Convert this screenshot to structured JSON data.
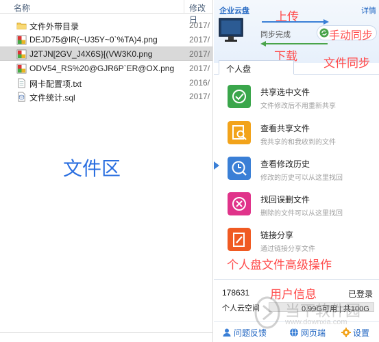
{
  "file_list": {
    "header_name": "名称",
    "header_modified": "修改日",
    "files": [
      {
        "name": "文件外带目录",
        "date": "2017/",
        "icon": "folder-icon"
      },
      {
        "name": "DEJD75@IR(~U35Y~0`%TA)4.png",
        "date": "2017/",
        "icon": "png-file-icon"
      },
      {
        "name": "J2TJN[2GV_J4X6S}[(VW3K0.png",
        "date": "2017/",
        "icon": "png-file-icon"
      },
      {
        "name": "ODV54_RS%20@GJR6P`ER@OX.png",
        "date": "2017/",
        "icon": "png-file-icon"
      },
      {
        "name": "网卡配置项.txt",
        "date": "2016/",
        "icon": "txt-file-icon"
      },
      {
        "name": "文件统计.sql",
        "date": "2017/",
        "icon": "sql-file-icon"
      }
    ],
    "zone_label": "文件区"
  },
  "sync_panel": {
    "brand": "企业云盘",
    "details": "详情",
    "upload_label": "上传",
    "status": "同步完成",
    "manual_sync_label": "手动同步",
    "download_label": "下载",
    "file_sync_label": "文件同步",
    "tab": "个人盘",
    "actions": [
      {
        "title": "共享选中文件",
        "desc": "文件修改后不用重新共享",
        "icon": "share-sync-icon",
        "color": "#3aa64b"
      },
      {
        "title": "查看共享文件",
        "desc": "我共享的和我收到的文件",
        "icon": "search-file-icon",
        "color": "#f2a31b"
      },
      {
        "title": "查看修改历史",
        "desc": "修改的历史可以从这里找回",
        "icon": "history-icon",
        "color": "#3a7fd6"
      },
      {
        "title": "找回误删文件",
        "desc": "删除的文件可以从这里找回",
        "icon": "restore-icon",
        "color": "#e0338a"
      },
      {
        "title": "链接分享",
        "desc": "通过链接分享文件",
        "icon": "link-share-icon",
        "color": "#f05a22"
      }
    ],
    "advanced_label": "个人盘文件高级操作",
    "user_id": "178631",
    "user_info_label": "用户信息",
    "login_status": "已登录",
    "quota_label": "个人云空间",
    "quota_text": "0.99G可用 | 共100G",
    "footer": {
      "feedback": "问题反馈",
      "web": "网页端",
      "settings": "设置"
    }
  },
  "watermark": {
    "text": "当下软件园",
    "url": "www.downxia.com"
  }
}
